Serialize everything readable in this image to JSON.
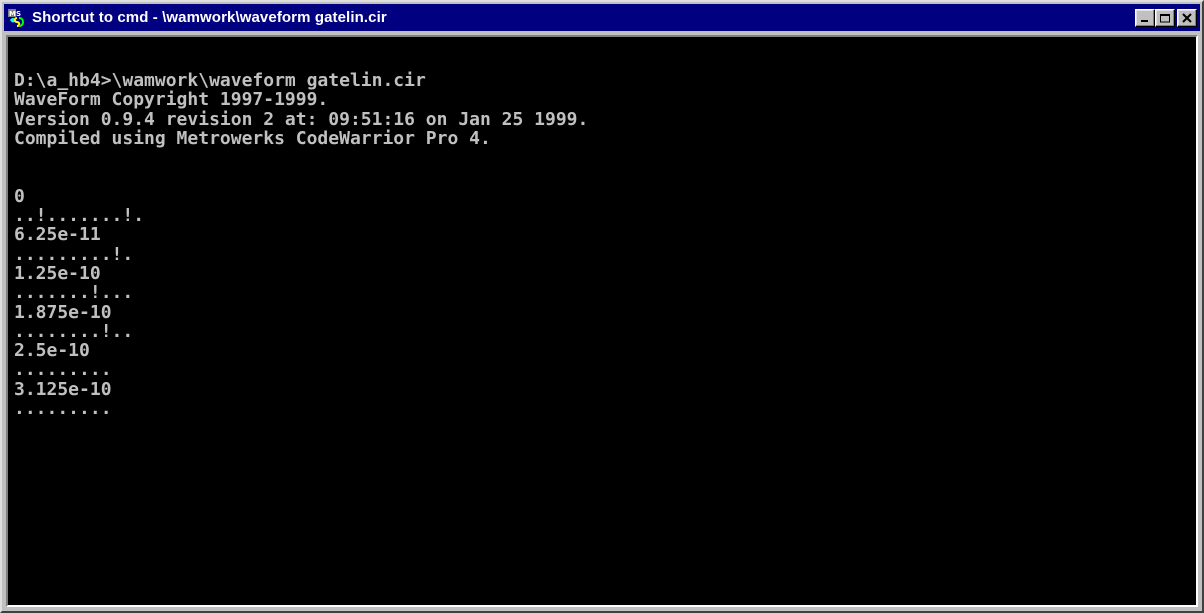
{
  "window": {
    "title": "Shortcut to cmd - \\wamwork\\waveform gatelin.cir",
    "icon": "ms-dos-icon",
    "buttons": {
      "minimize": "minimize-icon",
      "maximize": "maximize-icon",
      "close": "close-icon"
    }
  },
  "console": {
    "lines": [
      "D:\\a_hb4>\\wamwork\\waveform gatelin.cir",
      "WaveForm Copyright 1997-1999.",
      "Version 0.9.4 revision 2 at: 09:51:16 on Jan 25 1999.",
      "Compiled using Metrowerks CodeWarrior Pro 4.",
      "",
      "",
      "0",
      "..!.......!.",
      "6.25e-11",
      ".........!.",
      "1.25e-10",
      ".......!...",
      "1.875e-10",
      "........!..",
      "2.5e-10",
      ".........",
      "3.125e-10",
      "........."
    ]
  },
  "colors": {
    "titlebar": "#000080",
    "console_background": "#000000",
    "console_text": "#c0c0c0",
    "chrome": "#c0c0c0"
  }
}
